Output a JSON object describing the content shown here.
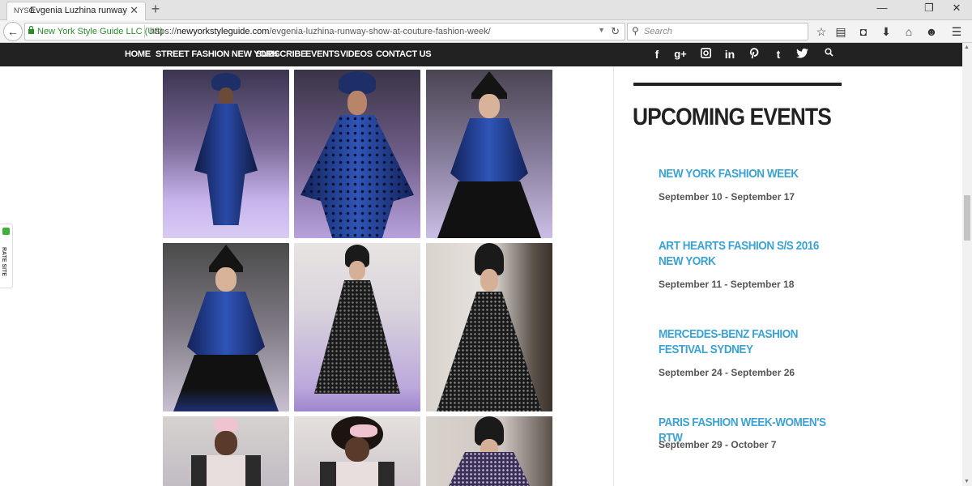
{
  "browser": {
    "tab_title": "Evgenia Luzhina runway s...",
    "tab_favicon_text": "NYSG",
    "identity": "New York Style Guide LLC (US)",
    "url_prefix": "https://",
    "url_domain": "newyorkstyleguide.com",
    "url_path": "/evgenia-luzhina-runway-show-at-couture-fashion-week/",
    "search_placeholder": "Search"
  },
  "site_nav": {
    "items": [
      "HOME",
      "STREET FASHION NEW YORK",
      "SUBSCRIBE",
      "EVENTS",
      "VIDEOS",
      "CONTACT US"
    ],
    "social": [
      "f",
      "g+",
      "instagram-icon",
      "in",
      "pinterest-icon",
      "t",
      "twitter-icon",
      "search-icon"
    ]
  },
  "sidebar": {
    "title": "UPCOMING EVENTS",
    "events": [
      {
        "title": "NEW YORK FASHION WEEK",
        "dates": "September 10 - September 17"
      },
      {
        "title": "ART HEARTS FASHION S/S 2016 NEW YORK",
        "dates": "September 11 - September 18"
      },
      {
        "title": "MERCEDES-BENZ FASHION FESTIVAL SYDNEY",
        "dates": "September 24 - September 26"
      },
      {
        "title": "PARIS FASHION WEEK-WOMEN'S RTW",
        "dates": "September 29 - October 7"
      }
    ]
  },
  "rate_site": {
    "label": "RATE SITE"
  },
  "gallery": {
    "photos": [
      {
        "desc": "runway-photo",
        "outfit": "blue-dress"
      },
      {
        "desc": "runway-photo",
        "outfit": "blue-dress"
      },
      {
        "desc": "runway-photo",
        "outfit": "blue-child"
      },
      {
        "desc": "runway-photo",
        "outfit": "blue-child"
      },
      {
        "desc": "runway-photo",
        "outfit": "black-lace"
      },
      {
        "desc": "runway-photo",
        "outfit": "black-lace"
      },
      {
        "desc": "runway-photo",
        "outfit": "floral"
      },
      {
        "desc": "runway-photo",
        "outfit": "floral"
      },
      {
        "desc": "runway-photo",
        "outfit": "purple-lace"
      }
    ]
  },
  "colors": {
    "nav_bg": "#222222",
    "accent": "#3aa3d4",
    "date_text": "#555555",
    "heading": "#222222"
  }
}
